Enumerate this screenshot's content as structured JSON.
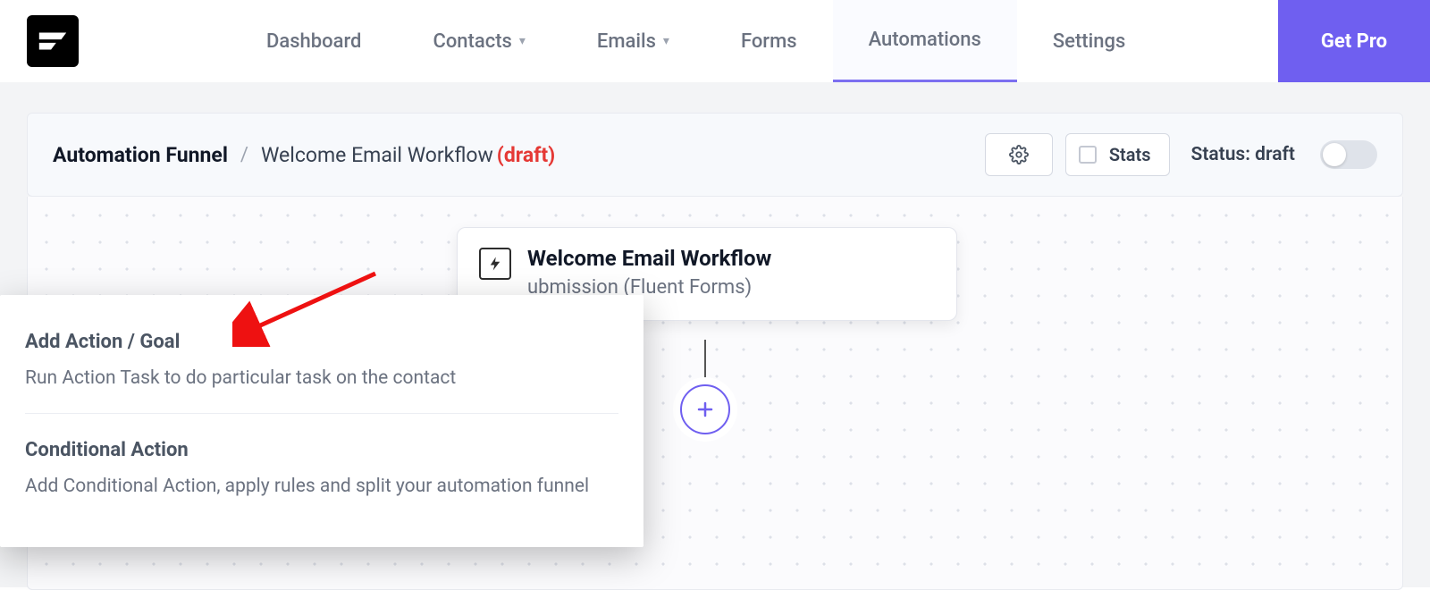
{
  "nav": {
    "items": [
      {
        "label": "Dashboard"
      },
      {
        "label": "Contacts",
        "chevron": true
      },
      {
        "label": "Emails",
        "chevron": true
      },
      {
        "label": "Forms"
      },
      {
        "label": "Automations",
        "active": true
      },
      {
        "label": "Settings"
      }
    ],
    "cta": "Get Pro"
  },
  "header": {
    "title": "Automation Funnel",
    "sep": "/",
    "workflow": "Welcome Email Workflow",
    "draft_tag": "(draft)",
    "stats_label": "Stats",
    "status_text": "Status: draft"
  },
  "trigger": {
    "title": "Welcome Email Workflow",
    "subtitle": "ubmission (Fluent Forms)"
  },
  "popup": {
    "items": [
      {
        "title": "Add Action / Goal",
        "desc": "Run Action Task to do particular task on the contact"
      },
      {
        "title": "Conditional Action",
        "desc": "Add Conditional Action, apply rules and split your automation funnel"
      }
    ]
  }
}
